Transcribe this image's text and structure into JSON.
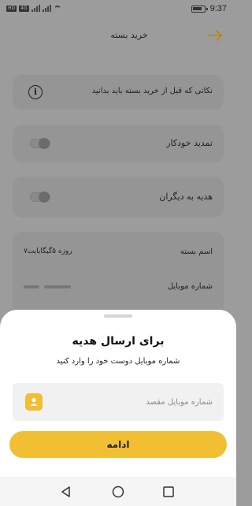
{
  "status_bar": {
    "sim_label": "HD",
    "network_label": "4G",
    "time": "9:37"
  },
  "header": {
    "title": "خرید بسته",
    "back_icon": "arrow-right-icon"
  },
  "cards": {
    "note_text": "نکاتی که قبل از خرید بسته باید بدانید",
    "auto_renew_label": "تمدید خودکار",
    "gift_label": "هدیه به دیگران",
    "package_name_label": "اسم بسته",
    "package_name_value": "۷روزه ۵گیگابایت",
    "mobile_label": "شماره موبایل"
  },
  "sheet": {
    "title": "برای ارسال هدیه",
    "subtitle": "شماره موبایل دوست خود را وارد کنید",
    "phone_placeholder": "شماره موبایل مقصد",
    "continue_label": "ادامه"
  },
  "colors": {
    "accent": "#f2bf33",
    "overlay": "#9c9c9c",
    "sheet_bg": "#ffffff"
  }
}
